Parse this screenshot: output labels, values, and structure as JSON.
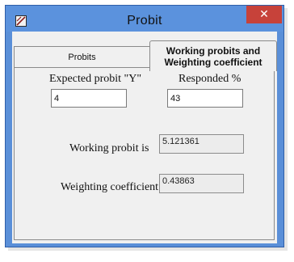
{
  "window": {
    "title": "Probit",
    "close_glyph": "✕",
    "app_icon": "app-icon"
  },
  "tabs": [
    {
      "label": "Probits",
      "active": false
    },
    {
      "label_line1": "Working probits and",
      "label_line2": "Weighting coefficient",
      "active": true
    }
  ],
  "form": {
    "expected_label": "Expected probit \"Y\"",
    "expected_value": "4",
    "responded_label": "Responded %",
    "responded_value": "43",
    "working_label": "Working probit is",
    "working_value": "5.121361",
    "weighting_label": "Weighting coefficient",
    "weighting_value": "0.43863"
  }
}
